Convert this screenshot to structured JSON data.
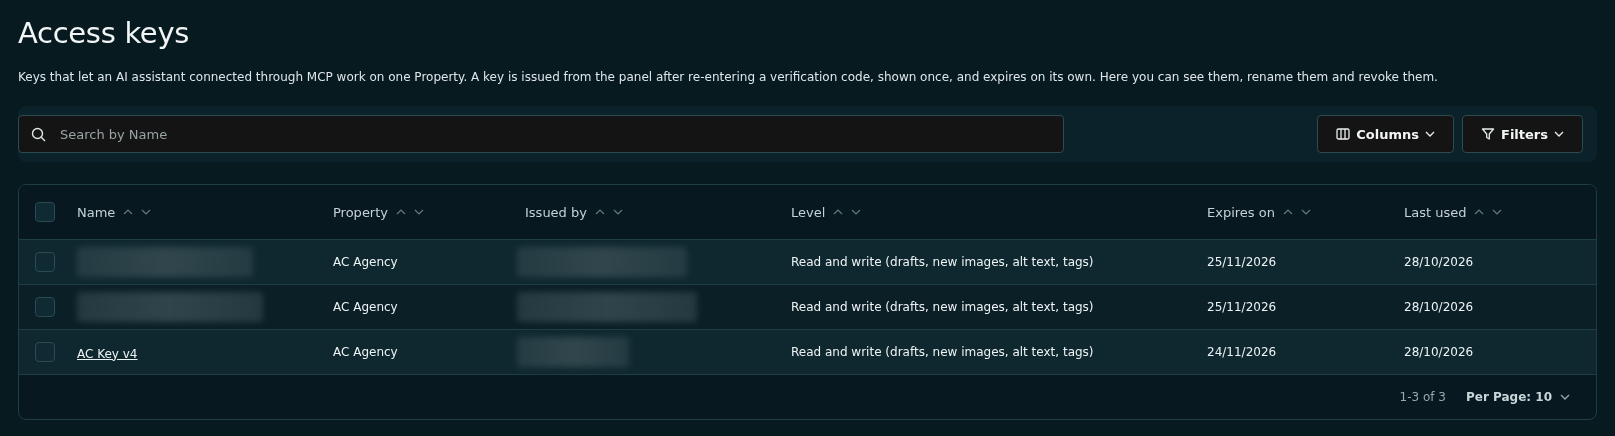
{
  "page": {
    "title": "Access keys",
    "description": "Keys that let an AI assistant connected through MCP work on one Property. A key is issued from the panel after re-entering a verification code, shown once, and expires on its own. Here you can see them, rename them and revoke them."
  },
  "toolbar": {
    "search": {
      "placeholder": "Search by Name"
    },
    "buttons": [
      {
        "kind": "columns",
        "label": "Columns"
      },
      {
        "kind": "filters",
        "label": "Filters"
      }
    ]
  },
  "table": {
    "select_all": {
      "checked": false
    },
    "columns": [
      "Name",
      "Property",
      "Issued by",
      "Level",
      "Expires on",
      "Last used"
    ],
    "rows": [
      {
        "checked": false,
        "name": {
          "kind": "blurred"
        },
        "property": "AC Agency",
        "issued_by": {
          "kind": "blurred"
        },
        "level": "Read and write (drafts, new images, alt text, tags)",
        "expires_on": "25/11/2026",
        "last_used": "28/10/2026"
      },
      {
        "checked": false,
        "name": {
          "kind": "blurred"
        },
        "property": "AC Agency",
        "issued_by": {
          "kind": "blurred"
        },
        "level": "Read and write (drafts, new images, alt text, tags)",
        "expires_on": "25/11/2026",
        "last_used": "28/10/2026"
      },
      {
        "checked": false,
        "name": {
          "kind": "link",
          "text": "AC Key v4"
        },
        "property": "AC Agency",
        "issued_by": {
          "kind": "blurred"
        },
        "level": "Read and write (drafts, new images, alt text, tags)",
        "expires_on": "24/11/2026",
        "last_used": "28/10/2026"
      }
    ],
    "footer": {
      "range": "1-3 of 3",
      "per_page": "Per Page: 10"
    }
  }
}
